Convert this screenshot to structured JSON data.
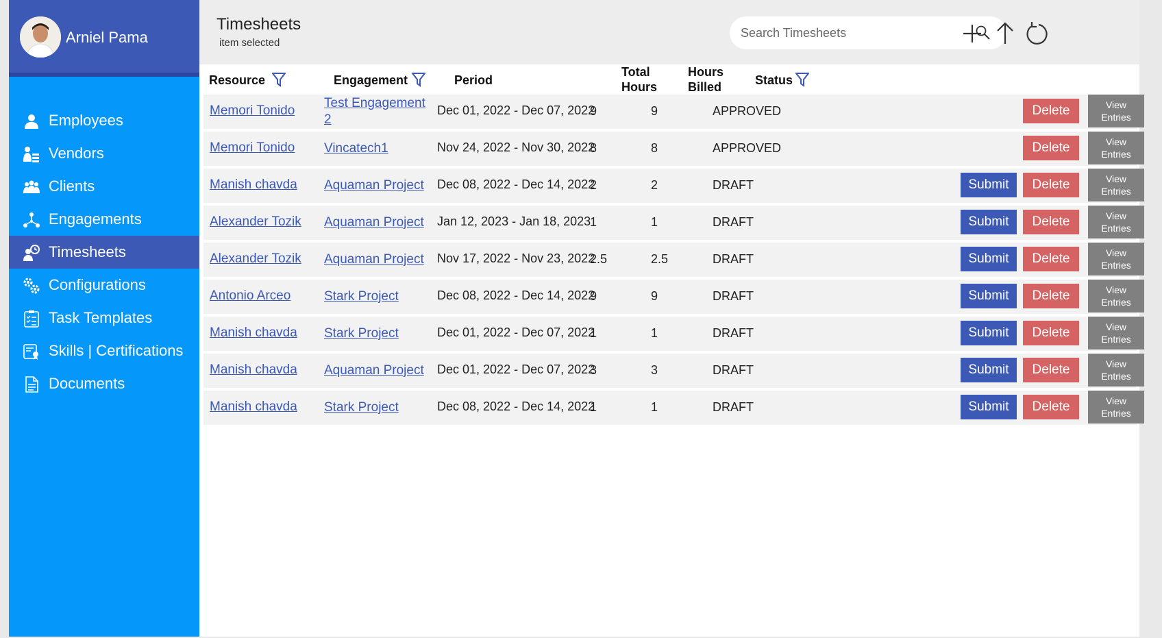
{
  "user": {
    "name": "Arniel Pama"
  },
  "sidebar": {
    "items": [
      {
        "label": "Employees",
        "icon": "person-icon"
      },
      {
        "label": "Vendors",
        "icon": "vendor-icon"
      },
      {
        "label": "Clients",
        "icon": "group-icon"
      },
      {
        "label": "Engagements",
        "icon": "network-icon"
      },
      {
        "label": "Timesheets",
        "icon": "timesheet-icon",
        "active": true
      },
      {
        "label": "Configurations",
        "icon": "gears-icon"
      },
      {
        "label": "Task Templates",
        "icon": "clipboard-icon"
      },
      {
        "label": "Skills | Certifications",
        "icon": "certificate-icon"
      },
      {
        "label": "Documents",
        "icon": "document-icon"
      }
    ]
  },
  "header": {
    "title": "Timesheets",
    "subtitle": "item selected",
    "search_placeholder": "Search Timesheets"
  },
  "table": {
    "columns": {
      "resource": "Resource",
      "engagement": "Engagement",
      "period": "Period",
      "total_hours_1": "Total",
      "total_hours_2": "Hours",
      "hours_billed_1": "Hours",
      "hours_billed_2": "Billed",
      "status": "Status"
    },
    "buttons": {
      "submit": "Submit",
      "delete": "Delete",
      "view_1": "View",
      "view_2": "Entries"
    },
    "rows": [
      {
        "resource": "Memori Tonido",
        "engagement": "Test Engagement 2",
        "period": "Dec 01, 2022 - Dec 07, 2022",
        "total": "9",
        "billed": "9",
        "status": "APPROVED",
        "submit": false
      },
      {
        "resource": "Memori Tonido",
        "engagement": "Vincatech1",
        "period": "Nov 24, 2022 - Nov 30, 2022",
        "total": "8",
        "billed": "8",
        "status": "APPROVED",
        "submit": false
      },
      {
        "resource": "Manish chavda",
        "engagement": "Aquaman Project",
        "period": "Dec 08, 2022 - Dec 14, 2022",
        "total": "2",
        "billed": "2",
        "status": "DRAFT",
        "submit": true
      },
      {
        "resource": "Alexander Tozik",
        "engagement": "Aquaman Project",
        "period": "Jan 12, 2023 - Jan 18, 2023",
        "total": "1",
        "billed": "1",
        "status": "DRAFT",
        "submit": true
      },
      {
        "resource": "Alexander Tozik",
        "engagement": "Aquaman Project",
        "period": "Nov 17, 2022 - Nov 23, 2022",
        "total": "2.5",
        "billed": "2.5",
        "status": "DRAFT",
        "submit": true
      },
      {
        "resource": "Antonio Arceo",
        "engagement": "Stark Project",
        "period": "Dec 08, 2022 - Dec 14, 2022",
        "total": "9",
        "billed": "9",
        "status": "DRAFT",
        "submit": true
      },
      {
        "resource": "Manish chavda",
        "engagement": "Stark Project",
        "period": "Dec 01, 2022 - Dec 07, 2022",
        "total": "1",
        "billed": "1",
        "status": "DRAFT",
        "submit": true
      },
      {
        "resource": "Manish chavda",
        "engagement": "Aquaman Project",
        "period": "Dec 01, 2022 - Dec 07, 2022",
        "total": "3",
        "billed": "3",
        "status": "DRAFT",
        "submit": true
      },
      {
        "resource": "Manish chavda",
        "engagement": "Stark Project",
        "period": "Dec 08, 2022 - Dec 14, 2022",
        "total": "1",
        "billed": "1",
        "status": "DRAFT",
        "submit": true
      }
    ]
  }
}
